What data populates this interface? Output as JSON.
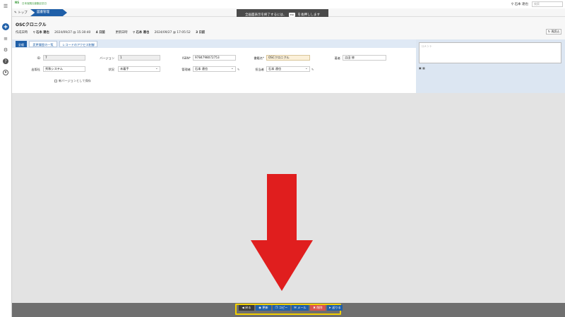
{
  "topbar": {
    "logo_mark": "NS",
    "org_name": "日本保険社募集記念日",
    "user_name": "石本 達也",
    "search_placeholder": "検索"
  },
  "banner": {
    "text_before": "全画面表示を終了するには、",
    "key": "esc",
    "text_after": "を長押しします"
  },
  "breadcrumb": {
    "home": "トップ",
    "current": "図書管理"
  },
  "header": {
    "title": "OSCクロニクル",
    "created_label": "作成日時",
    "created_by": "石本 達也",
    "created_at": "2024/09/27 @ 15:30:40",
    "created_ago": "4 日前",
    "updated_label": "更新日時",
    "updated_by": "石本 達也",
    "updated_at": "2024/09/27 @ 17:05:52",
    "updated_ago": "3 日前",
    "reload_label": "再読込"
  },
  "tabs": [
    {
      "label": "全般"
    },
    {
      "label": "変更履歴の一覧"
    },
    {
      "label": "レコードのアクセス制御"
    }
  ],
  "form": {
    "id": {
      "label": "ID",
      "value": "7"
    },
    "version": {
      "label": "バージョン",
      "value": "1"
    },
    "isbn": {
      "label": "ISBN",
      "value": "9784798072753"
    },
    "book_name": {
      "label": "書籍名",
      "value": "OSCクロニクル"
    },
    "author": {
      "label": "著者",
      "value": "吉田 修"
    },
    "publisher": {
      "label": "出版社",
      "value": "秀和システム"
    },
    "status": {
      "label": "状況",
      "value": "未着手"
    },
    "manager": {
      "label": "管理者",
      "value": "石本 達也"
    },
    "owner": {
      "label": "担当者",
      "value": "石本 達也"
    },
    "save_as_new_version": "新バージョンとして保存"
  },
  "comment": {
    "placeholder": "コメント"
  },
  "footer": {
    "buttons": [
      {
        "label": "戻る",
        "color": "#3a3a3a",
        "icon": "back-icon"
      },
      {
        "label": "更新",
        "color": "#1f5fa8",
        "icon": "update-icon"
      },
      {
        "label": "コピー",
        "color": "#1f5fa8",
        "icon": "copy-icon"
      },
      {
        "label": "メール",
        "color": "#1f5fa8",
        "icon": "mail-icon"
      },
      {
        "label": "削除",
        "color": "#d9534f",
        "icon": "trash-icon"
      },
      {
        "label": "送りる",
        "color": "#1f5fa8",
        "icon": "send-icon"
      }
    ]
  },
  "colors": {
    "accent": "#1f5fa8",
    "highlight_frame": "#f2d000",
    "arrow": "#e01e1e",
    "delete": "#d9534f"
  }
}
